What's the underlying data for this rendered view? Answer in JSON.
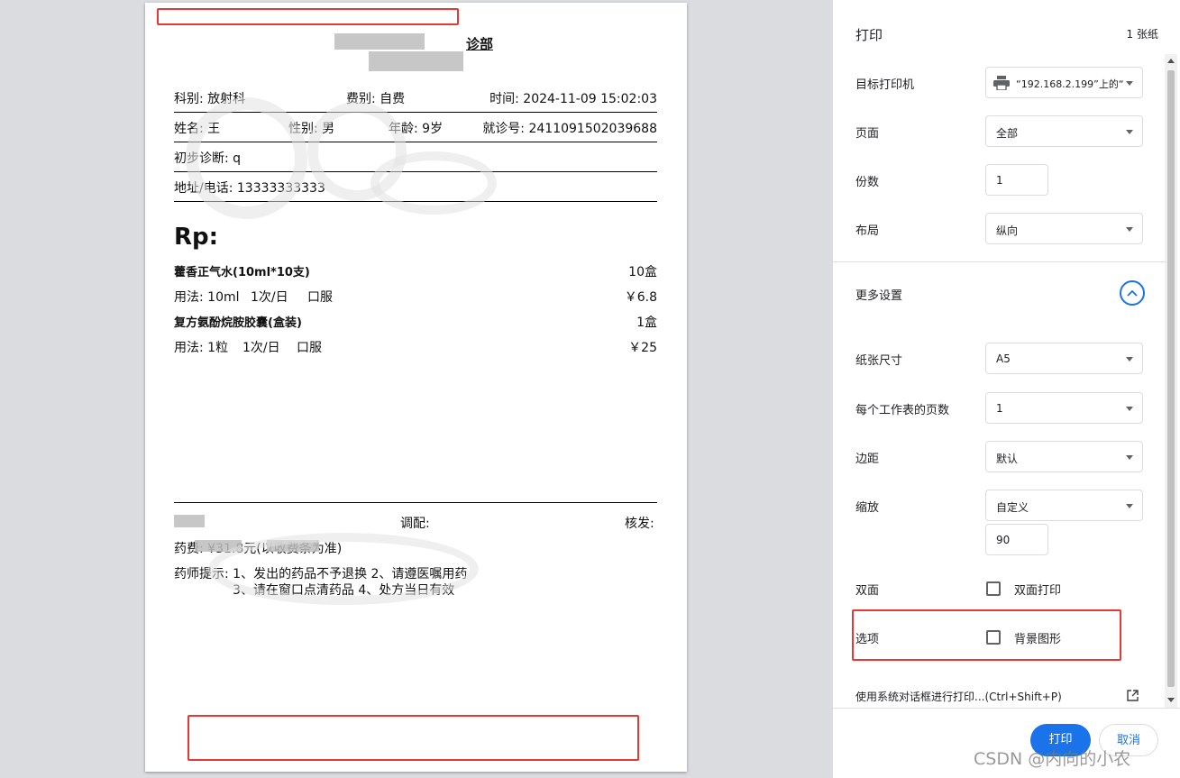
{
  "receipt": {
    "header_title": "诊部",
    "department": "科别: 放射科",
    "fee_type": "费别: 自费",
    "time": "时间: 2024-11-09 15:02:03",
    "name": "姓名: 王",
    "gender": "性别: 男",
    "age": "年龄: 9岁",
    "visit_no": "就诊号: 2411091502039688",
    "diagnosis": "初步诊断: q",
    "phone": "地址/电话: 13333333333",
    "rp_symbol": "Rp:",
    "items": [
      {
        "name": "藿香正气水(10ml*10支)",
        "qty": "10盒",
        "usage": [
          "用法: 10ml",
          "1次/日",
          "口服"
        ],
        "price": "￥6.8"
      },
      {
        "name": "复方氨酚烷胺胶囊(盒装)",
        "qty": "1盒",
        "usage": [
          "用法: 1粒",
          "1次/日",
          "口服"
        ],
        "price": "￥25"
      }
    ],
    "dispense_label": "调配:",
    "review_label": "核发:",
    "fee_note": "药费: ¥31.8元(以收费条为准)",
    "tips_line1": "药师提示: 1、发出的药品不予退换  2、请遵医嘱用药",
    "tips_line2": "3、请在窗口点清药品  4、处方当日有效"
  },
  "panel": {
    "title": "打印",
    "sheet_count": "1 张纸",
    "printer_label": "目标打印机",
    "printer_value": "“192.168.2.199”上的“",
    "pages_label": "页面",
    "pages_value": "全部",
    "copies_label": "份数",
    "copies_value": "1",
    "layout_label": "布局",
    "layout_value": "纵向",
    "more_settings_label": "更多设置",
    "paper_size_label": "纸张尺寸",
    "paper_size_value": "A5",
    "pages_per_sheet_label": "每个工作表的页数",
    "pages_per_sheet_value": "1",
    "margins_label": "边距",
    "margins_value": "默认",
    "scale_label": "缩放",
    "scale_value": "自定义",
    "scale_percent": "90",
    "duplex_label": "双面",
    "duplex_checkbox_label": "双面打印",
    "options_label": "选项",
    "background_checkbox_label": "背景图形",
    "system_dialog_label": "使用系统对话框进行打印...(Ctrl+Shift+P)",
    "print_button": "打印",
    "cancel_button": "取消"
  },
  "colors": {
    "accent": "#1a73e8",
    "highlight_red": "#e53935"
  },
  "watermark_text": "CSDN @内向的小农"
}
